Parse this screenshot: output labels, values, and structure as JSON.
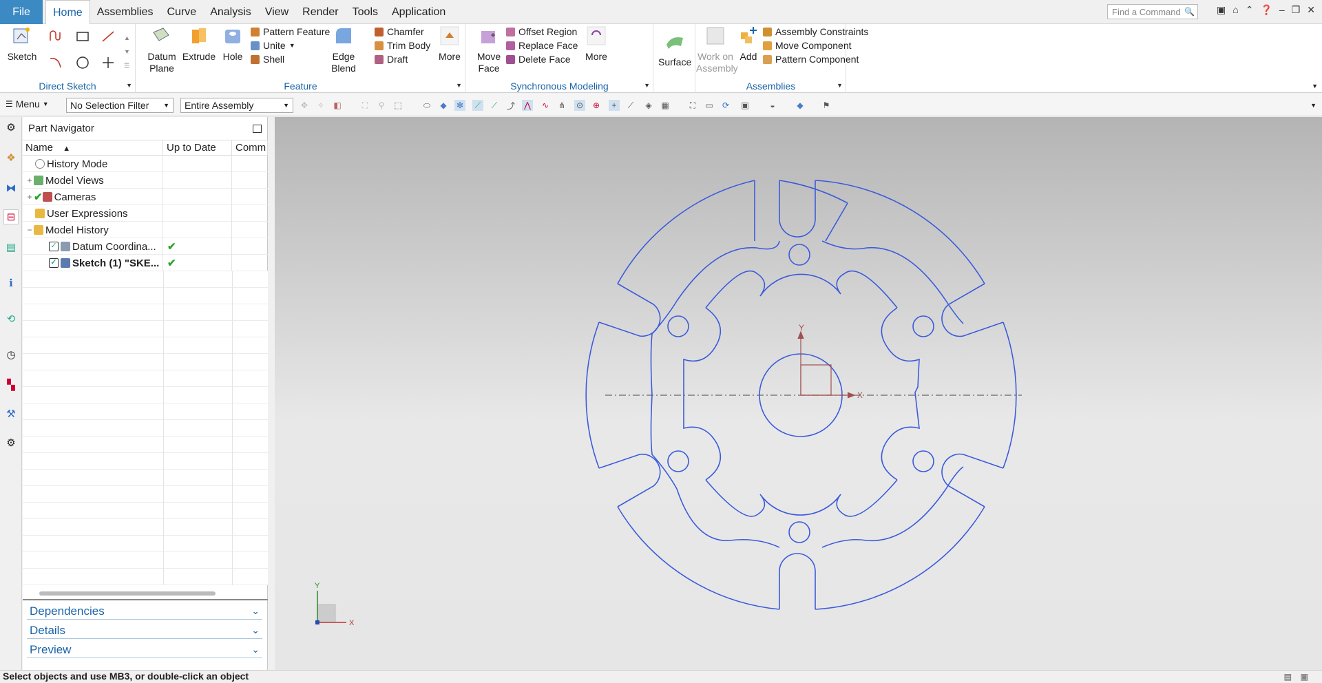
{
  "menubar": {
    "file": "File",
    "tabs": [
      "Home",
      "Assemblies",
      "Curve",
      "Analysis",
      "View",
      "Render",
      "Tools",
      "Application"
    ],
    "find_placeholder": "Find a Command"
  },
  "ribbon": {
    "direct_sketch": {
      "title": "Direct Sketch",
      "sketch": "Sketch"
    },
    "feature": {
      "title": "Feature",
      "datum_plane": "Datum Plane",
      "extrude": "Extrude",
      "hole": "Hole",
      "pattern_feature": "Pattern Feature",
      "unite": "Unite",
      "shell": "Shell",
      "edge_blend": "Edge Blend",
      "chamfer": "Chamfer",
      "trim_body": "Trim Body",
      "draft": "Draft",
      "more": "More"
    },
    "sync": {
      "title": "Synchronous Modeling",
      "move_face": "Move Face",
      "offset_region": "Offset Region",
      "replace_face": "Replace Face",
      "delete_face": "Delete Face",
      "more": "More"
    },
    "surface": {
      "label": "Surface"
    },
    "assemblies": {
      "title": "Assemblies",
      "work_on_assembly": "Work on Assembly",
      "add": "Add",
      "assembly_constraints": "Assembly Constraints",
      "move_component": "Move Component",
      "pattern_component": "Pattern Component"
    }
  },
  "toolbar": {
    "menu": "Menu",
    "selection_filter": "No Selection Filter",
    "scope": "Entire Assembly"
  },
  "navigator": {
    "title": "Part Navigator",
    "columns": [
      "Name",
      "Up to Date",
      "Comm"
    ],
    "rows": [
      {
        "name": "History Mode",
        "status": ""
      },
      {
        "name": "Model Views",
        "status": ""
      },
      {
        "name": "Cameras",
        "status": ""
      },
      {
        "name": "User Expressions",
        "status": ""
      },
      {
        "name": "Model History",
        "status": ""
      },
      {
        "name": "Datum Coordina...",
        "status": "✔"
      },
      {
        "name": "Sketch (1) \"SKE...",
        "status": "✔"
      }
    ],
    "panels": [
      "Dependencies",
      "Details",
      "Preview"
    ]
  },
  "viewport": {
    "axis_x": "X",
    "axis_y": "Y",
    "triad_x": "X",
    "triad_y": "Y"
  },
  "status": "Select objects and use MB3, or double-click an object",
  "colors": {
    "accent": "#1a64a8",
    "file": "#3c8ac4",
    "sketch": "#3b5bdb"
  }
}
